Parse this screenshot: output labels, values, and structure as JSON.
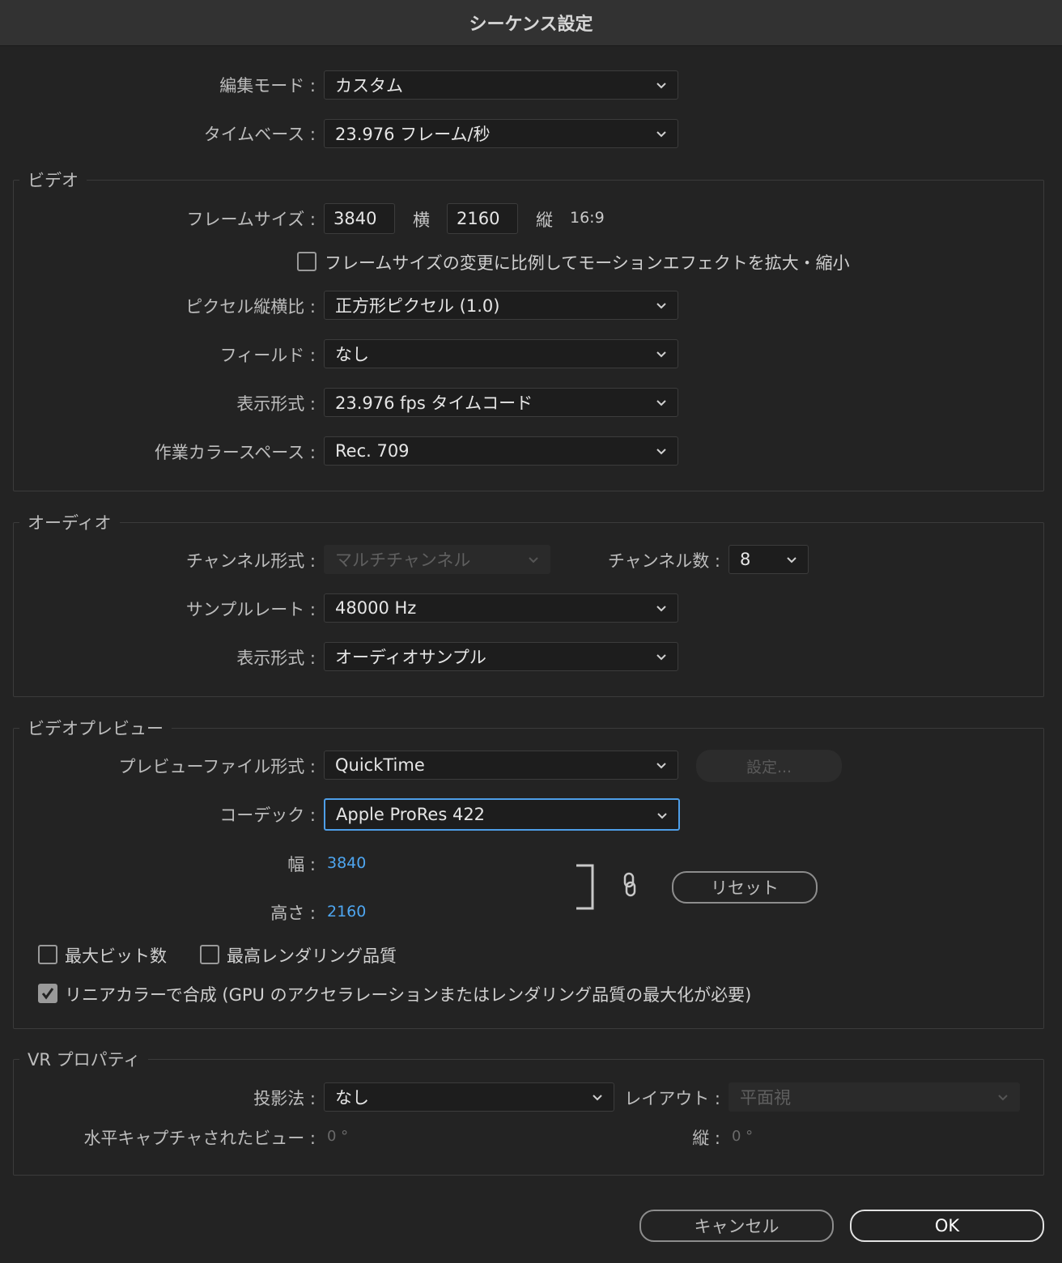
{
  "window": {
    "title": "シーケンス設定"
  },
  "general": {
    "edit_mode_label": "編集モード",
    "edit_mode_value": "カスタム",
    "timebase_label": "タイムベース",
    "timebase_value": "23.976  フレーム/秒"
  },
  "video": {
    "group_title": "ビデオ",
    "frame_size_label": "フレームサイズ",
    "frame_width": "3840",
    "horizontal_label": "横",
    "frame_height": "2160",
    "vertical_label": "縦",
    "aspect": "16:9",
    "scale_checkbox_label": "フレームサイズの変更に比例してモーションエフェクトを拡大・縮小",
    "pixel_aspect_label": "ピクセル縦横比",
    "pixel_aspect_value": "正方形ピクセル (1.0)",
    "fields_label": "フィールド",
    "fields_value": "なし",
    "display_format_label": "表示形式",
    "display_format_value": "23.976 fps タイムコード",
    "color_space_label": "作業カラースペース",
    "color_space_value": "Rec. 709"
  },
  "audio": {
    "group_title": "オーディオ",
    "channel_format_label": "チャンネル形式",
    "channel_format_value": "マルチチャンネル",
    "channel_count_label": "チャンネル数",
    "channel_count_value": "8",
    "sample_rate_label": "サンプルレート",
    "sample_rate_value": "48000 Hz",
    "display_format_label": "表示形式",
    "display_format_value": "オーディオサンプル"
  },
  "preview": {
    "group_title": "ビデオプレビュー",
    "file_format_label": "プレビューファイル形式",
    "file_format_value": "QuickTime",
    "settings_button": "設定...",
    "codec_label": "コーデック",
    "codec_value": "Apple ProRes 422",
    "width_label": "幅",
    "width_value": "3840",
    "height_label": "高さ",
    "height_value": "2160",
    "reset_button": "リセット",
    "max_bit_label": "最大ビット数",
    "max_quality_label": "最高レンダリング品質",
    "linear_color_label": "リニアカラーで合成 (GPU のアクセラレーションまたはレンダリング品質の最大化が必要)"
  },
  "vr": {
    "group_title": "VR プロパティ",
    "projection_label": "投影法",
    "projection_value": "なし",
    "layout_label": "レイアウト",
    "layout_value": "平面視",
    "h_captured_label": "水平キャプチャされたビュー",
    "h_captured_value": "0 °",
    "vertical_label": "縦",
    "vertical_value": "0 °"
  },
  "footer": {
    "cancel_button": "キャンセル",
    "ok_button": "OK"
  }
}
